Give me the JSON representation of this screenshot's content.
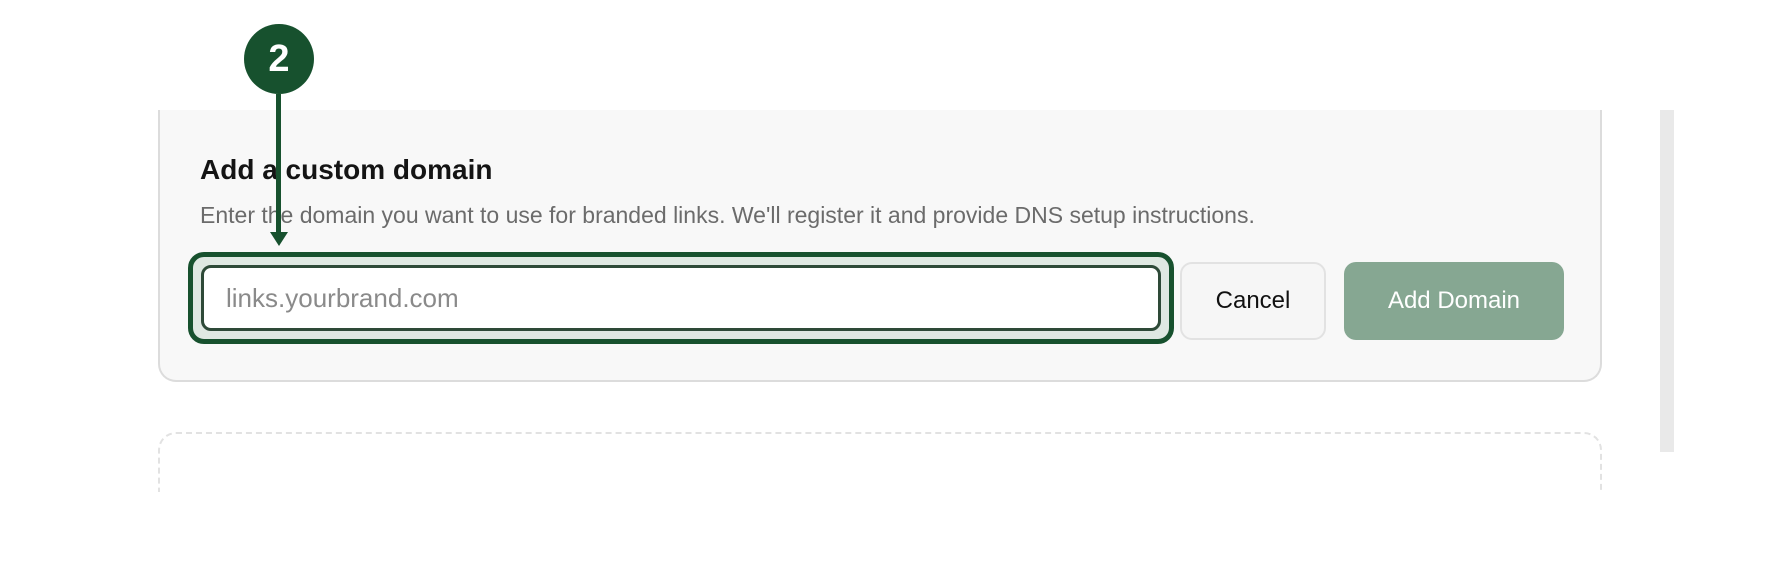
{
  "annotation": {
    "step_number": "2"
  },
  "domain_card": {
    "title": "Add a custom domain",
    "description": "Enter the domain you want to use for branded links. We'll register it and provide DNS setup instructions.",
    "input": {
      "placeholder": "links.yourbrand.com",
      "value": ""
    },
    "cancel_label": "Cancel",
    "add_label": "Add Domain"
  },
  "colors": {
    "accent": "#17512e",
    "add_button_disabled": "#86a792",
    "card_background": "#f8f8f8"
  }
}
